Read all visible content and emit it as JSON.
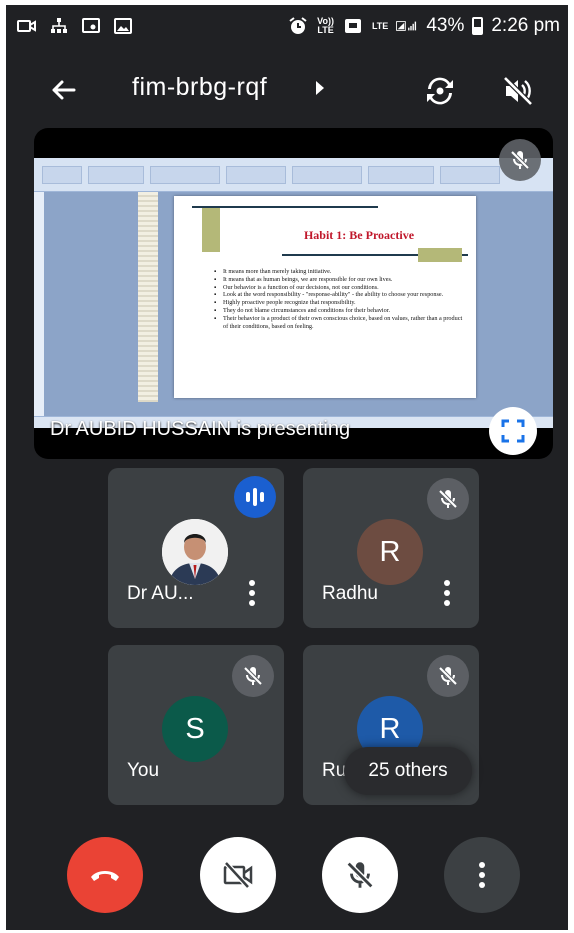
{
  "status_bar": {
    "icons_left": [
      "screen-record-icon",
      "network-share-icon",
      "cast-icon",
      "image-icon"
    ],
    "volte_label": "Vo))\nLTE",
    "lte_label": "LTE",
    "battery": "43%",
    "battery_level": 0.43,
    "time": "2:26 pm"
  },
  "app_bar": {
    "meeting_code": "fim-brbg-rqf",
    "icons": [
      "back-arrow-icon",
      "switch-camera-icon",
      "speaker-off-icon"
    ]
  },
  "presentation": {
    "presenter_caption": "Dr AUBID HUSSAIN is presenting",
    "slide": {
      "title": "Habit 1: Be Proactive",
      "bullets": [
        "It means more than merely taking initiative.",
        "It means that as human beings, we are responsible for our own lives.",
        "Our behavior is a function of our decisions, not our conditions.",
        "Look at the word responsibility - \"response-ability\" - the ability to choose your response.",
        "Highly proactive people recognize that responsibility.",
        "They do not blame circumstances and conditions for their behavior.",
        "Their behavior is a product of their own conscious choice, based on values, rather than a product of their conditions, based on feeling."
      ]
    }
  },
  "participants": [
    {
      "name": "Dr AU...",
      "initial": "",
      "avatar_color": "#ffffff",
      "state": "speaking"
    },
    {
      "name": "Radhu",
      "initial": "R",
      "avatar_color": "#6d4c41",
      "state": "muted"
    },
    {
      "name": "You",
      "initial": "S",
      "avatar_color": "#0b5a4a",
      "state": "muted"
    },
    {
      "name": "Ru",
      "initial": "R",
      "avatar_color": "#1e5aa8",
      "state": "muted"
    }
  ],
  "others_label": "25 others",
  "controls": {
    "end_call_color": "#ea4335",
    "icons": [
      "end-call-icon",
      "camera-off-icon",
      "mic-off-icon",
      "more-options-icon"
    ]
  },
  "colors": {
    "background": "#202124",
    "tile": "#3c4043",
    "speaking_badge": "#1a5fd0",
    "slide_title": "#c0172b"
  }
}
